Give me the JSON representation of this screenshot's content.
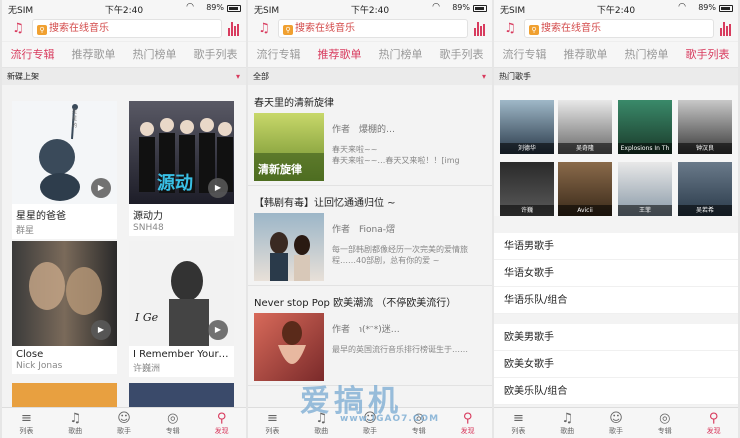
{
  "colors": {
    "accent": "#d83b5e"
  },
  "status_bar": {
    "carrier": "无SIM",
    "time": "下午2:40",
    "battery": "89%"
  },
  "search": {
    "placeholder": "搜索在线音乐"
  },
  "tabs": [
    "流行专辑",
    "推荐歌单",
    "热门榜单",
    "歌手列表"
  ],
  "bottom_nav": [
    {
      "label": "列表",
      "icon": "list-music-icon"
    },
    {
      "label": "歌曲",
      "icon": "music-note-icon"
    },
    {
      "label": "歌手",
      "icon": "person-icon"
    },
    {
      "label": "专辑",
      "icon": "disc-icon"
    },
    {
      "label": "发现",
      "icon": "search-icon"
    }
  ],
  "screen1": {
    "section": "新碟上架",
    "albums": [
      {
        "title": "星星的爸爸",
        "artist": "群星"
      },
      {
        "title": "源动力",
        "artist": "SNH48"
      },
      {
        "title": "Close",
        "artist": "Nick Jonas"
      },
      {
        "title": "I Remember Your…",
        "artist": "许巍洲"
      }
    ]
  },
  "screen2": {
    "section": "全部",
    "playlists": [
      {
        "title": "春天里的清新旋律",
        "author": "作者　爆棚的…",
        "desc": "春天来啦~~\n春天来啦~~…春天又来啦！！[img"
      },
      {
        "title": "【韩剧有毒】让回忆通通归位 ~",
        "author": "作者　Fiona-熠",
        "desc": "每一部韩剧都像经历一次完美的爱情旅程……40部剧，总有你的爱 ~"
      },
      {
        "title": "Never stop Pop 欧美潮流 （不停欧美流行）",
        "author": "作者　℩(*ᵔ*)迷…",
        "desc": "最早的英国流行音乐排行榜诞生于……"
      }
    ]
  },
  "screen3": {
    "section": "热门歌手",
    "singers": [
      "刘德华",
      "吴奇隆",
      "Explosions In Th",
      "钟汉良",
      "许巍",
      "Avicii",
      "王菲",
      "吴若希"
    ],
    "categories": [
      [
        "华语男歌手",
        "华语女歌手",
        "华语乐队/组合"
      ],
      [
        "欧美男歌手",
        "欧美女歌手",
        "欧美乐队/组合"
      ]
    ]
  },
  "watermark": {
    "main": "爱搞机",
    "sub": "www.IGAO7.COM"
  }
}
